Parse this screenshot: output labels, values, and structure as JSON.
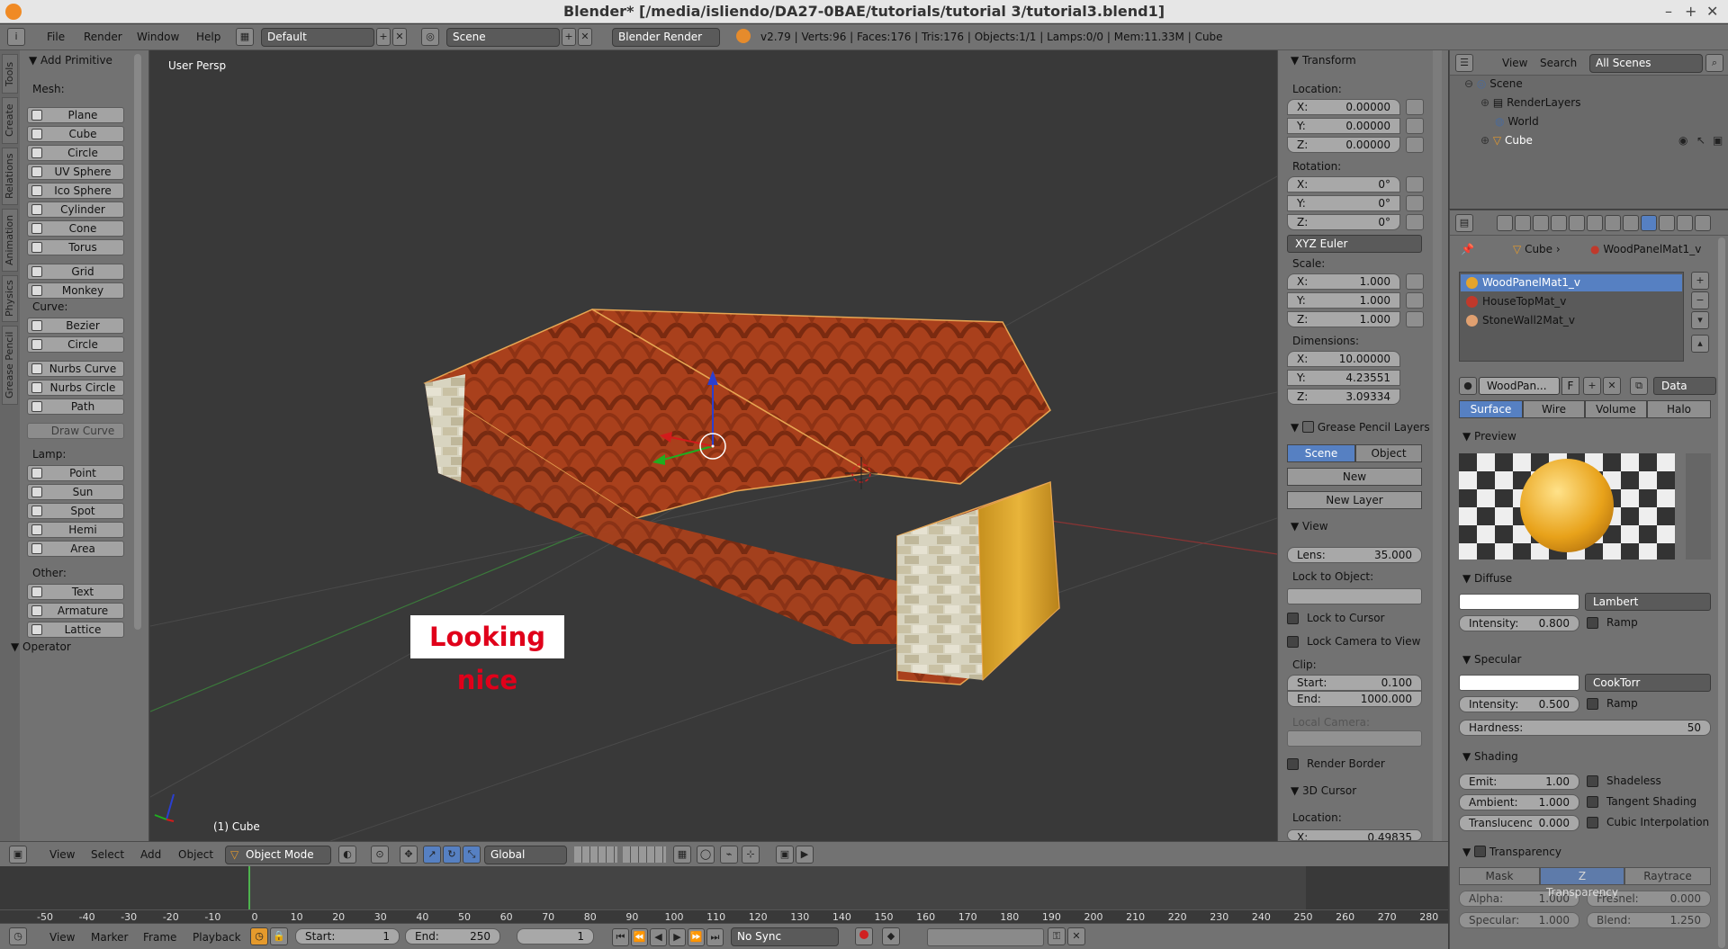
{
  "window": {
    "title": "Blender* [/media/isliendo/DA27-0BAE/tutorials/tutorial 3/tutorial3.blend1]"
  },
  "infobar": {
    "menus": [
      "File",
      "Render",
      "Window",
      "Help"
    ],
    "layout": "Default",
    "scene": "Scene",
    "engine": "Blender Render",
    "stats": "v2.79 | Verts:96 | Faces:176 | Tris:176 | Objects:1/1 | Lamps:0/0 | Mem:11.33M | Cube"
  },
  "tool_tabs": [
    "Tools",
    "Create",
    "Relations",
    "Animation",
    "Physics",
    "Grease Pencil"
  ],
  "tools": {
    "panel_title": "Add Primitive",
    "mesh_label": "Mesh:",
    "mesh": [
      "Plane",
      "Cube",
      "Circle",
      "UV Sphere",
      "Ico Sphere",
      "Cylinder",
      "Cone",
      "Torus",
      "Grid",
      "Monkey"
    ],
    "curve_label": "Curve:",
    "curve": [
      "Bezier",
      "Circle",
      "Nurbs Curve",
      "Nurbs Circle",
      "Path"
    ],
    "draw_curve": "Draw Curve",
    "lamp_label": "Lamp:",
    "lamp": [
      "Point",
      "Sun",
      "Spot",
      "Hemi",
      "Area"
    ],
    "other_label": "Other:",
    "other": [
      "Text",
      "Armature",
      "Lattice"
    ],
    "operator": "Operator"
  },
  "viewport": {
    "view_name": "User Persp",
    "object_label": "(1) Cube",
    "caption": "Looking nice"
  },
  "npanel": {
    "transform": "Transform",
    "location": "Location:",
    "loc": [
      {
        "k": "X:",
        "v": "0.00000"
      },
      {
        "k": "Y:",
        "v": "0.00000"
      },
      {
        "k": "Z:",
        "v": "0.00000"
      }
    ],
    "rotation": "Rotation:",
    "rot": [
      {
        "k": "X:",
        "v": "0°"
      },
      {
        "k": "Y:",
        "v": "0°"
      },
      {
        "k": "Z:",
        "v": "0°"
      }
    ],
    "rot_mode": "XYZ Euler",
    "scale": "Scale:",
    "scl": [
      {
        "k": "X:",
        "v": "1.000"
      },
      {
        "k": "Y:",
        "v": "1.000"
      },
      {
        "k": "Z:",
        "v": "1.000"
      }
    ],
    "dimensions": "Dimensions:",
    "dim": [
      {
        "k": "X:",
        "v": "10.00000"
      },
      {
        "k": "Y:",
        "v": "4.23551"
      },
      {
        "k": "Z:",
        "v": "3.09334"
      }
    ],
    "gp_layers": "Grease Pencil Layers",
    "gp_scene": "Scene",
    "gp_object": "Object",
    "gp_new": "New",
    "gp_new_layer": "New Layer",
    "view": "View",
    "lens_k": "Lens:",
    "lens_v": "35.000",
    "lock_to_object": "Lock to Object:",
    "lock_cursor": "Lock to Cursor",
    "lock_camera": "Lock Camera to View",
    "clip": "Clip:",
    "clip_start_k": "Start:",
    "clip_start_v": "0.100",
    "clip_end_k": "End:",
    "clip_end_v": "1000.000",
    "local_camera": "Local Camera:",
    "render_border": "Render Border",
    "cursor3d": "3D Cursor",
    "cursor_loc": "Location:",
    "cursor_x_k": "X:",
    "cursor_x_v": "0.49835"
  },
  "outliner": {
    "menus": [
      "View",
      "Search"
    ],
    "filter": "All Scenes",
    "items": [
      "Scene",
      "RenderLayers",
      "World",
      "Cube"
    ]
  },
  "props": {
    "breadcrumb_obj": "Cube",
    "breadcrumb_mat": "WoodPanelMat1_v",
    "materials": [
      "WoodPanelMat1_v",
      "HouseTopMat_v",
      "StoneWall2Mat_v"
    ],
    "mat_name": "WoodPan...",
    "mat_f": "F",
    "mat_data": "Data",
    "tabs": [
      "Surface",
      "Wire",
      "Volume",
      "Halo"
    ],
    "preview": "Preview",
    "diffuse": "Diffuse",
    "diffuse_shader": "Lambert",
    "diffuse_int_k": "Intensity:",
    "diffuse_int_v": "0.800",
    "ramp": "Ramp",
    "specular": "Specular",
    "spec_shader": "CookTorr",
    "spec_int_k": "Intensity:",
    "spec_int_v": "0.500",
    "hardness_k": "Hardness:",
    "hardness_v": "50",
    "shading": "Shading",
    "emit_k": "Emit:",
    "emit_v": "1.00",
    "ambient_k": "Ambient:",
    "ambient_v": "1.000",
    "transluc_k": "Translucenc",
    "transluc_v": "0.000",
    "shadeless": "Shadeless",
    "tangent": "Tangent Shading",
    "cubic": "Cubic Interpolation",
    "transparency": "Transparency",
    "trans_tabs": [
      "Mask",
      "Z Transparency",
      "Raytrace"
    ],
    "alpha_k": "Alpha:",
    "alpha_v": "1.000",
    "fresnel_k": "Fresnel:",
    "fresnel_v": "0.000",
    "specular2_k": "Specular:",
    "specular2_v": "1.000",
    "blend_k": "Blend:",
    "blend_v": "1.250"
  },
  "vpheader": {
    "menus": [
      "View",
      "Select",
      "Add",
      "Object"
    ],
    "mode": "Object Mode",
    "orientation": "Global"
  },
  "timeline": {
    "ticks": [
      "-50",
      "-40",
      "-30",
      "-20",
      "-10",
      "0",
      "10",
      "20",
      "30",
      "40",
      "50",
      "60",
      "70",
      "80",
      "90",
      "100",
      "110",
      "120",
      "130",
      "140",
      "150",
      "160",
      "170",
      "180",
      "190",
      "200",
      "210",
      "220",
      "230",
      "240",
      "250",
      "260",
      "270",
      "280"
    ]
  },
  "tlheader": {
    "menus": [
      "View",
      "Marker",
      "Frame",
      "Playback"
    ],
    "start_k": "Start:",
    "start_v": "1",
    "end_k": "End:",
    "end_v": "250",
    "current": "1",
    "sync": "No Sync"
  },
  "colors": {
    "selection": "#5680c2",
    "caption_text": "#e0001a"
  }
}
